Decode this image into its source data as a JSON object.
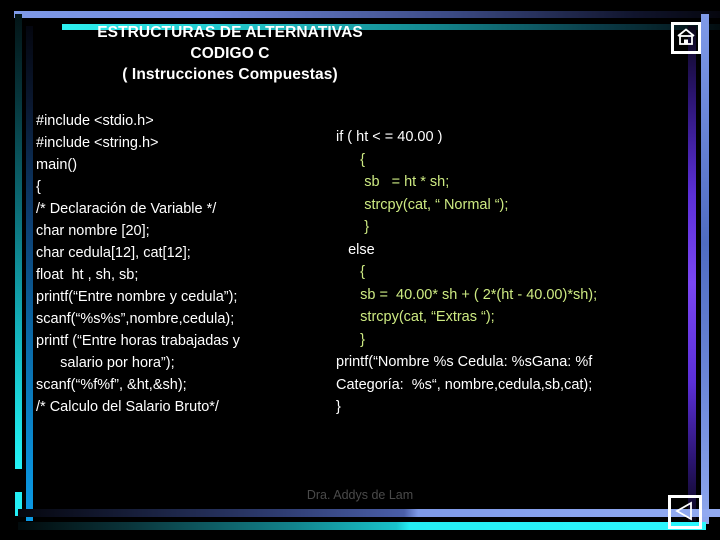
{
  "slide": {
    "title": {
      "line1": "ESTRUCTURAS DE ALTERNATIVAS",
      "line2": "CODIGO C",
      "line3": "( Instrucciones Compuestas)"
    },
    "code_left": "#include <stdio.h>\n#include <string.h>\nmain()\n{\n/* Declaración de Variable */\nchar nombre [20];\nchar cedula[12], cat[12];\nfloat  ht , sh, sb;\nprintf(“Entre nombre y cedula”);\nscanf(“%s%s”,nombre,cedula);\nprintf (“Entre horas trabajadas y\n      salario por hora”);\nscanf(“%f%f”, &ht,&sh);\n/* Calculo del Salario Bruto*/",
    "code_right_lines": [
      {
        "text": "if ( ht < = 40.00 )",
        "highlight": false
      },
      {
        "text": "      {",
        "highlight": true
      },
      {
        "text": "       sb   = ht * sh;",
        "highlight": true
      },
      {
        "text": "       strcpy(cat, “ Normal “);",
        "highlight": true
      },
      {
        "text": "       }",
        "highlight": true
      },
      {
        "text": "   else",
        "highlight": false
      },
      {
        "text": "      {",
        "highlight": true
      },
      {
        "text": "      sb =  40.00* sh + ( 2*(ht - 40.00)*sh);",
        "highlight": true
      },
      {
        "text": "      strcpy(cat, “Extras “);",
        "highlight": true
      },
      {
        "text": "      }",
        "highlight": true
      },
      {
        "text": "printf(“Nombre %s Cedula: %sGana: %f",
        "highlight": false
      },
      {
        "text": "Categoría:  %s“, nombre,cedula,sb,cat);",
        "highlight": false
      },
      {
        "text": "}",
        "highlight": false
      }
    ],
    "footer_credit": "Dra. Addys de Lam",
    "nav": {
      "home_label": "home-icon",
      "back_label": "previous-slide-icon"
    },
    "colors": {
      "background": "#000000",
      "text": "#ffffff",
      "highlight": "#cdea82",
      "accent_cyan": "#25f2f6",
      "accent_blue": "#7f9ae8",
      "accent_purple": "#7a46f2",
      "footer_text": "#4a4a4a"
    }
  }
}
